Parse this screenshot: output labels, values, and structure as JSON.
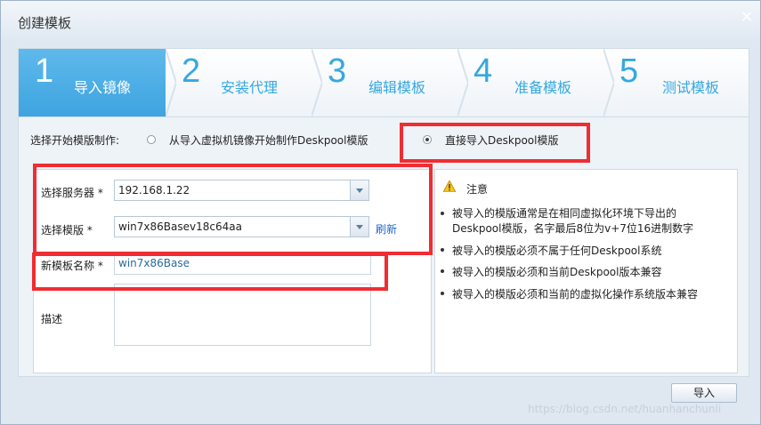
{
  "dialog": {
    "title": "创建模板",
    "close_label": "×"
  },
  "steps": [
    {
      "num": "1",
      "label": "导入镜像",
      "active": true
    },
    {
      "num": "2",
      "label": "安装代理",
      "active": false
    },
    {
      "num": "3",
      "label": "编辑模板",
      "active": false
    },
    {
      "num": "4",
      "label": "准备模板",
      "active": false
    },
    {
      "num": "5",
      "label": "测试模板",
      "active": false
    }
  ],
  "mode": {
    "label": "选择开始模版制作:",
    "option_vm": "从导入虚拟机镜像开始制作Deskpool模版",
    "option_direct": "直接导入Deskpool模版",
    "selected": "direct"
  },
  "form": {
    "server_label": "选择服务器 *",
    "server_value": "192.168.1.22",
    "template_label": "选择模版 *",
    "template_value": "win7x86Basev18c64aa",
    "refresh_label": "刷新",
    "name_label": "新模板名称 *",
    "name_value": "win7x86Base",
    "desc_label": "描述",
    "desc_value": ""
  },
  "note": {
    "title": "注意",
    "items": [
      "被导入的模版通常是在相同虚拟化环境下导出的",
      "Deskpool模版，名字最后8位为v+7位16进制数字",
      "被导入的模版必须不属于任何Deskpool系统",
      "被导入的模版必须和当前Deskpool版本兼容",
      "被导入的模版必须和当前的虚拟化操作系统版本兼容"
    ]
  },
  "footer": {
    "import_label": "导入"
  },
  "watermark": "https://blog.csdn.net/huanhanchunli",
  "colors": {
    "accent": "#3ea4e0",
    "highlight": "#ef2d33",
    "link": "#2266cc"
  }
}
